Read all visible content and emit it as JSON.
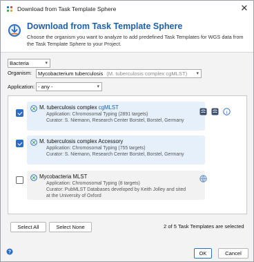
{
  "window": {
    "title": "Download from Task Template Sphere"
  },
  "header": {
    "title": "Download from Task Template Sphere",
    "description": "Choose the organism you want to analyze to add predefined Task Templates for WGS data from the Task Template Sphere to your Project."
  },
  "filters": {
    "category": "Bacteria",
    "organism_label": "Organism:",
    "organism_value": "Mycobacterium tuberculosis",
    "organism_hint": "(M. tuberculosis complex cgMLST)",
    "application_label": "Application:",
    "application_value": "- any -"
  },
  "templates": [
    {
      "checked": true,
      "name_prefix": "M. tuberculosis complex ",
      "name_highlight": "cgMLST",
      "application": "Application: Chromosomal Typing (2891 targets)",
      "curator": "Curator: S. Niemann, Research Center Borstel, Borstel, Germany",
      "curator_extra": ""
    },
    {
      "checked": true,
      "name_prefix": "M. tuberculosis complex Accessory",
      "name_highlight": "",
      "application": "Application: Chromosomal Typing (755 targets)",
      "curator": "Curator: S. Niemann, Research Center Borstel, Borstel, Germany",
      "curator_extra": ""
    },
    {
      "checked": false,
      "name_prefix": "Mycobacteria MLST",
      "name_highlight": "",
      "application": "Application: Chromosomal Typing (8 targets)",
      "curator": "Curator: PubMLST Databases developed by Keith Jolley and sited",
      "curator_extra": "at the University of Oxford"
    }
  ],
  "buttons": {
    "select_all": "Select All",
    "select_none": "Select None",
    "ok": "OK",
    "cancel": "Cancel"
  },
  "status": {
    "selected_count": "2 of 5 Task Templates are selected"
  },
  "colors": {
    "accent": "#2b6cc4",
    "title_blue": "#1f5fa8",
    "card_selected": "#e5f0fa"
  }
}
